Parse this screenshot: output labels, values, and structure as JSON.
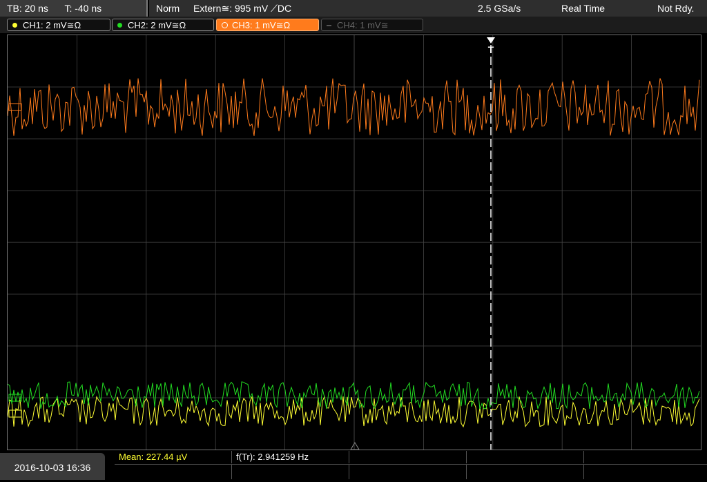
{
  "header": {
    "timebase": "TB: 20 ns",
    "trigger_time": "T: -40 ns",
    "trigger_mode": "Norm",
    "trigger_source": "Extern≅: 995 mV ⟋DC",
    "sample_rate": "2.5 GSa/s",
    "acq_mode": "Real Time",
    "status": "Not Rdy."
  },
  "channels": [
    {
      "label": "CH1: 2 mV≅Ω",
      "color": "#ffff33",
      "active": false,
      "enabled": true
    },
    {
      "label": "CH2: 2 mV≅Ω",
      "color": "#22dd22",
      "active": false,
      "enabled": true
    },
    {
      "label": "CH3: 1 mV≅Ω",
      "color": "#ff7b1c",
      "active": true,
      "enabled": true
    },
    {
      "label": "CH4: 1 mV≅",
      "color": "#777777",
      "active": false,
      "enabled": false
    }
  ],
  "measurements": {
    "mean": "Mean: 227.44 µV",
    "freq": "f(Tr): 2.941259 Hz"
  },
  "datetime": "2016-10-03 16:36",
  "colors": {
    "ch1": "#ffff33",
    "ch2": "#22dd22",
    "ch3": "#ff7b1c",
    "grid": "#444444",
    "trigger_marker": "#ffffff"
  }
}
